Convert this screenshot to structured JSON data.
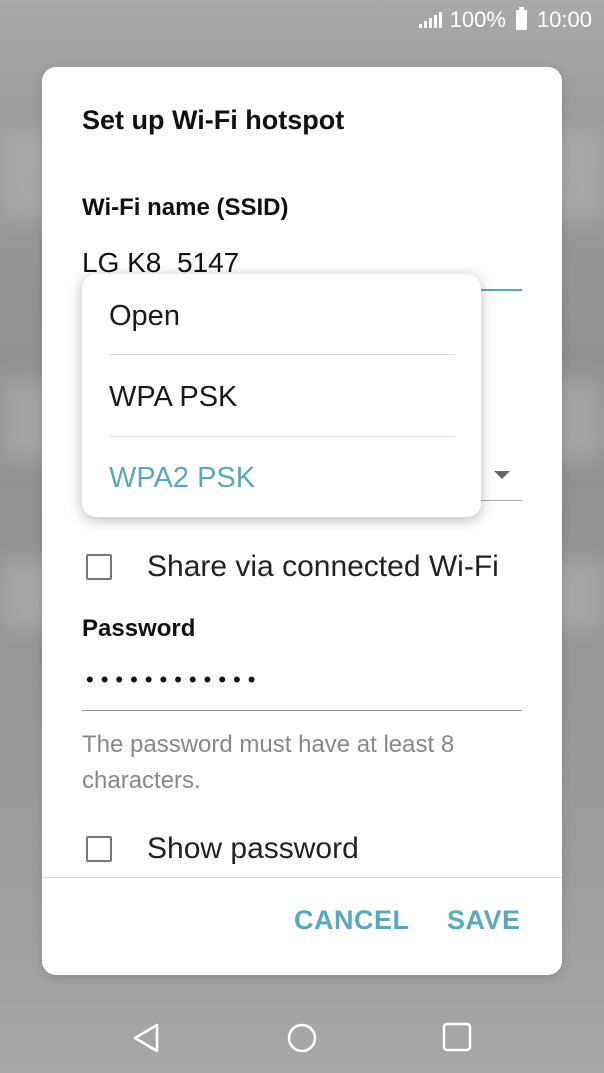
{
  "status_bar": {
    "battery_percent": "100%",
    "time": "10:00",
    "icons": [
      "signal-icon",
      "battery-icon"
    ]
  },
  "dialog": {
    "title": "Set up Wi-Fi hotspot",
    "ssid_label": "Wi-Fi name (SSID)",
    "ssid_value": "LG K8_5147",
    "share_label": "Share via connected Wi-Fi",
    "share_checked": false,
    "password_label": "Password",
    "password_masked": "••••••••••••",
    "hint": "The password must have at least 8 characters.",
    "show_password_label": "Show password",
    "show_password_checked": false,
    "cancel_label": "CANCEL",
    "save_label": "SAVE"
  },
  "security_menu": {
    "options": [
      {
        "label": "Open"
      },
      {
        "label": "WPA PSK"
      },
      {
        "label": "WPA2 PSK"
      }
    ],
    "selected": "WPA2 PSK"
  },
  "nav_bar": {
    "icons": [
      "back-icon",
      "home-icon",
      "recents-icon"
    ]
  },
  "colors": {
    "accent": "#5aa9b8",
    "scrim": "#9c9c9c"
  }
}
